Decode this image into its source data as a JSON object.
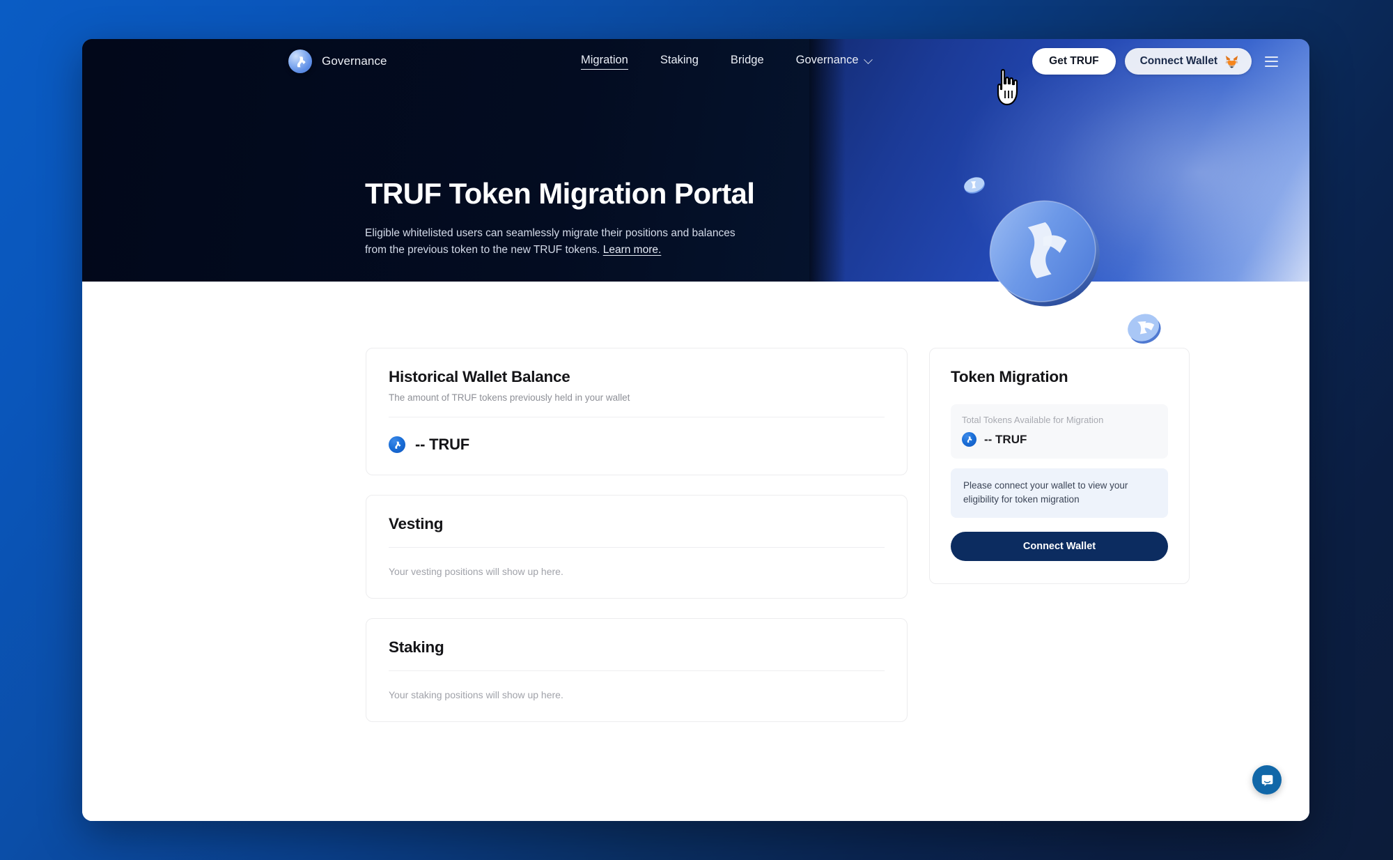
{
  "brand": {
    "logo_icon": "truflation-logo-icon",
    "name": "Governance"
  },
  "nav": {
    "links": [
      {
        "label": "Migration",
        "active": true
      },
      {
        "label": "Staking",
        "active": false
      },
      {
        "label": "Bridge",
        "active": false
      },
      {
        "label": "Governance",
        "active": false,
        "has_dropdown": true
      }
    ],
    "get_truf_label": "Get TRUF",
    "connect_wallet_label": "Connect Wallet",
    "wallet_icon": "metamask-fox-icon",
    "menu_icon": "hamburger-menu-icon"
  },
  "hero": {
    "title": "TRUF Token Migration Portal",
    "subtitle_part1": "Eligible whitelisted users can seamlessly migrate their positions and balances from the previous token to the new TRUF tokens. ",
    "learn_more_label": "Learn more.",
    "graphic": "truf-coin-3d-icon"
  },
  "main": {
    "historical_wallet": {
      "title": "Historical Wallet Balance",
      "subtitle": "The amount of TRUF tokens previously held in your wallet",
      "token_icon": "truf-token-icon",
      "balance": "-- TRUF"
    },
    "vesting": {
      "title": "Vesting",
      "empty_state": "Your vesting positions will show up here."
    },
    "staking": {
      "title": "Staking",
      "empty_state": "Your staking positions will show up here."
    }
  },
  "sidebar": {
    "token_migration": {
      "title": "Token Migration",
      "available_label": "Total Tokens Available for Migration",
      "token_icon": "truf-token-icon",
      "available_amount": "-- TRUF",
      "notice": "Please connect your wallet to view your eligibility for token migration",
      "connect_button_label": "Connect Wallet"
    }
  },
  "widgets": {
    "intercom_icon": "chat-bubble-icon"
  },
  "colors": {
    "brand_blue": "#1167a8",
    "primary_button": "#0c2c60",
    "token_blue": "#1b6fd8",
    "notice_bg": "#eef3fb",
    "hero_dark": "#030b1d"
  }
}
